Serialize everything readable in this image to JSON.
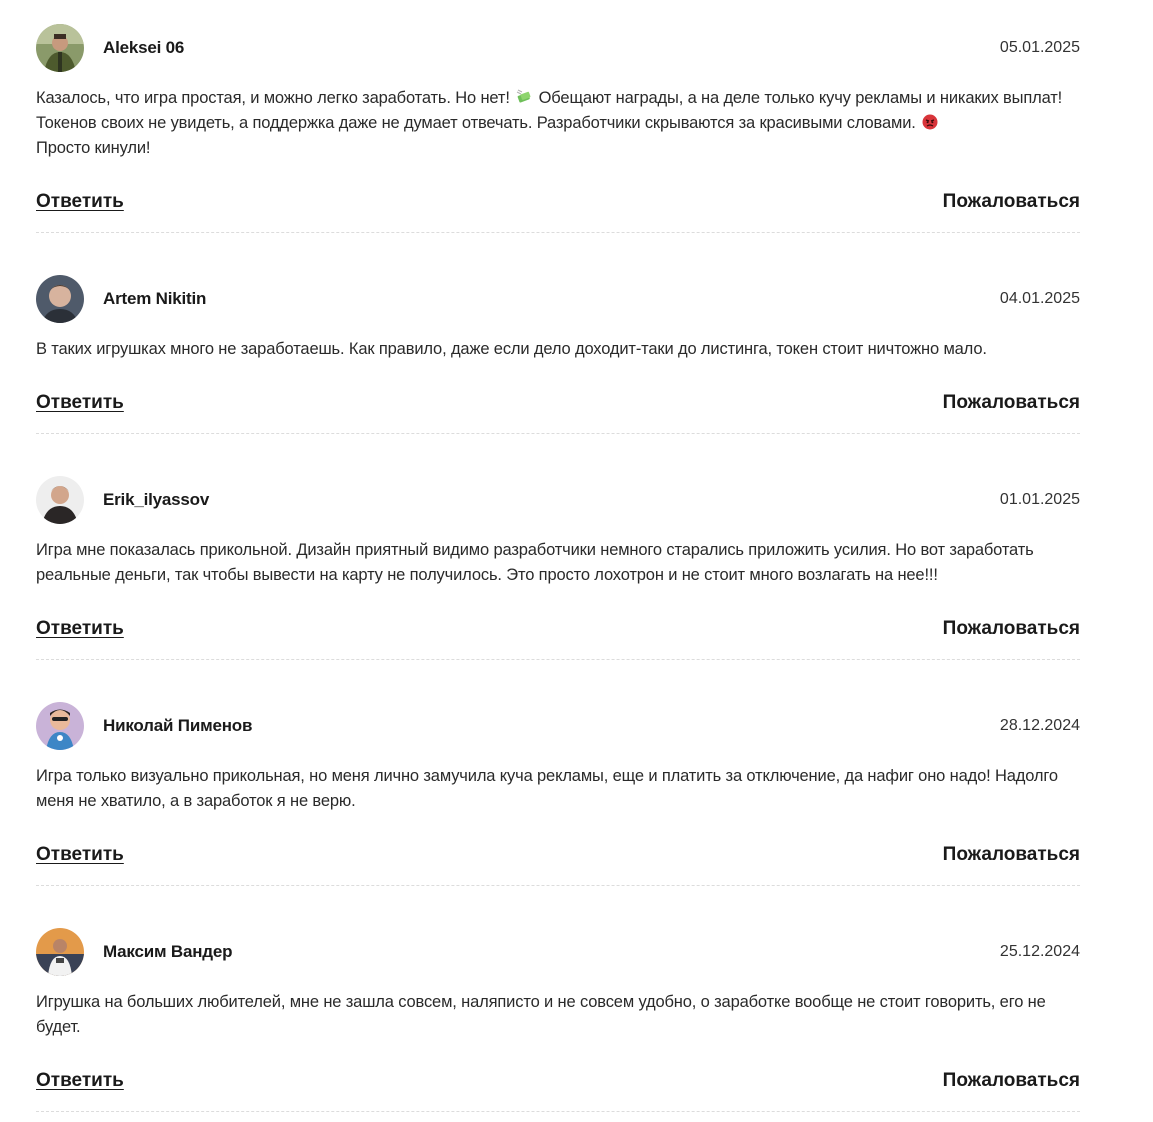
{
  "comments": [
    {
      "author": "Aleksei 06",
      "date": "05.01.2025",
      "text_parts": [
        "Казалось, что игра простая, и можно легко заработать. Но нет!",
        "Обещают награды, а на деле только кучу рекламы и никаких выплат! Токенов своих не увидеть, а поддержка даже не думает отвечать. Разработчики скрываются за красивыми словами.",
        "Просто кинули!"
      ],
      "emojis": [
        "money-with-wings",
        "angry-face"
      ],
      "avatar": "photo-man-green-jacket",
      "reply_label": "Ответить",
      "report_label": "Пожаловаться"
    },
    {
      "author": "Artem Nikitin",
      "date": "04.01.2025",
      "text": "В таких игрушках много не заработаешь. Как правило, даже если дело доходит-таки до листинга, токен стоит ничтожно мало.",
      "avatar": "photo-man-portrait",
      "reply_label": "Ответить",
      "report_label": "Пожаловаться"
    },
    {
      "author": "Erik_ilyassov",
      "date": "01.01.2025",
      "text": "Игра мне показалась прикольной. Дизайн приятный видимо разработчики немного старались приложить усилия. Но вот заработать реальные деньги, так чтобы вывести на карту не получилось. Это просто лохотрон и не стоит много возлагать на нее!!!",
      "avatar": "photo-man-dark-shirt",
      "reply_label": "Ответить",
      "report_label": "Пожаловаться"
    },
    {
      "author": "Николай Пименов",
      "date": "28.12.2024",
      "text": "Игра только визуально прикольная, но меня лично замучила куча рекламы, еще и платить за отключение, да нафиг оно надо! Надолго меня не хватило, а в заработок я не верю.",
      "avatar": "cartoon-3d-character",
      "reply_label": "Ответить",
      "report_label": "Пожаловаться"
    },
    {
      "author": "Максим Вандер",
      "date": "25.12.2024",
      "text": "Игрушка на больших любителей, мне не зашла совсем, наляписто и не совсем удобно, о заработке вообще не стоит говорить, его не будет.",
      "avatar": "photo-man-sunset",
      "reply_label": "Ответить",
      "report_label": "Пожаловаться"
    }
  ]
}
